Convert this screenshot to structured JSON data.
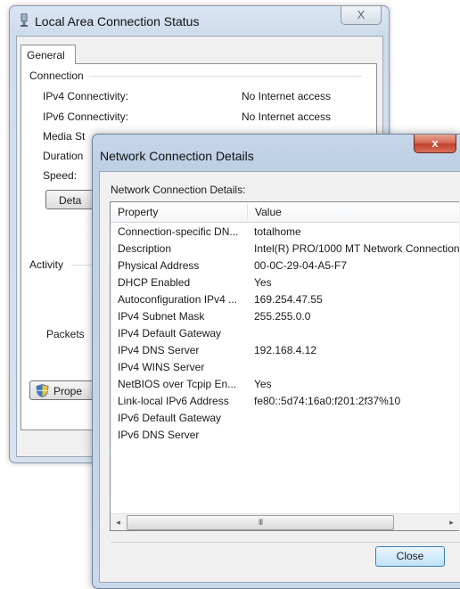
{
  "status_window": {
    "title": "Local Area Connection Status",
    "close_glyph": "X",
    "icon": "network-adapter-icon",
    "tab": "General",
    "connection_group": "Connection",
    "rows": [
      {
        "label": "IPv4 Connectivity:",
        "value": "No Internet access"
      },
      {
        "label": "IPv6 Connectivity:",
        "value": "No Internet access"
      },
      {
        "label": "Media St",
        "value": ""
      },
      {
        "label": "Duration",
        "value": ""
      },
      {
        "label": "Speed:",
        "value": ""
      }
    ],
    "details_button": "Deta",
    "activity_group": "Activity",
    "packets_label": "Packets",
    "properties_button": "Prope"
  },
  "details_window": {
    "title": "Network Connection Details",
    "close_glyph": "x",
    "section_label": "Network Connection Details:",
    "columns": [
      "Property",
      "Value"
    ],
    "rows": [
      {
        "property": "Connection-specific DN...",
        "value": "totalhome"
      },
      {
        "property": "Description",
        "value": "Intel(R) PRO/1000 MT Network Connection"
      },
      {
        "property": "Physical Address",
        "value": "00-0C-29-04-A5-F7"
      },
      {
        "property": "DHCP Enabled",
        "value": "Yes"
      },
      {
        "property": "Autoconfiguration IPv4 ...",
        "value": "169.254.47.55"
      },
      {
        "property": "IPv4 Subnet Mask",
        "value": "255.255.0.0"
      },
      {
        "property": "IPv4 Default Gateway",
        "value": ""
      },
      {
        "property": "IPv4 DNS Server",
        "value": "192.168.4.12"
      },
      {
        "property": "IPv4 WINS Server",
        "value": ""
      },
      {
        "property": "NetBIOS over Tcpip En...",
        "value": "Yes"
      },
      {
        "property": "Link-local IPv6 Address",
        "value": "fe80::5d74:16a0:f201:2f37%10"
      },
      {
        "property": "IPv6 Default Gateway",
        "value": ""
      },
      {
        "property": "IPv6 DNS Server",
        "value": ""
      }
    ],
    "scroll_left": "◂",
    "scroll_thumb_grip": "III",
    "scroll_right": "▸",
    "close_button": "Close"
  },
  "colors": {
    "aero_frame": "#cfdcec",
    "close_red": "#c3412a",
    "default_button_border": "#3c7fb1"
  }
}
